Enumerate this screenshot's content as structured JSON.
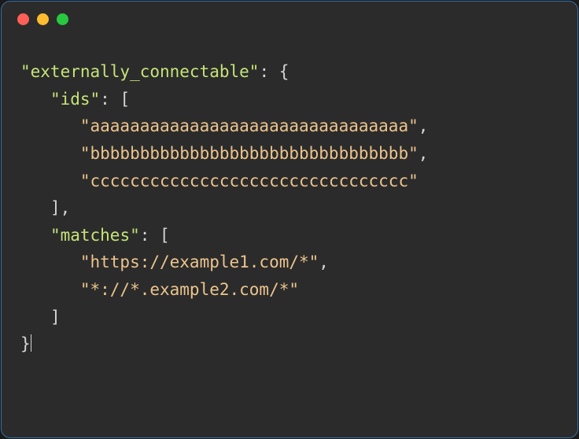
{
  "code": {
    "key1": "\"externally_connectable\"",
    "ids_key": "\"ids\"",
    "ids": [
      "\"aaaaaaaaaaaaaaaaaaaaaaaaaaaaaaaa\"",
      "\"bbbbbbbbbbbbbbbbbbbbbbbbbbbbbbbb\"",
      "\"cccccccccccccccccccccccccccccccc\""
    ],
    "matches_key": "\"matches\"",
    "matches": [
      "\"https://example1.com/*\"",
      "\"*://*.example2.com/*\""
    ],
    "punct": {
      "colon_brace": ": {",
      "colon_bracket": ": [",
      "comma": ",",
      "close_bracket_comma": "],",
      "close_bracket": "]",
      "close_brace": "}"
    }
  }
}
